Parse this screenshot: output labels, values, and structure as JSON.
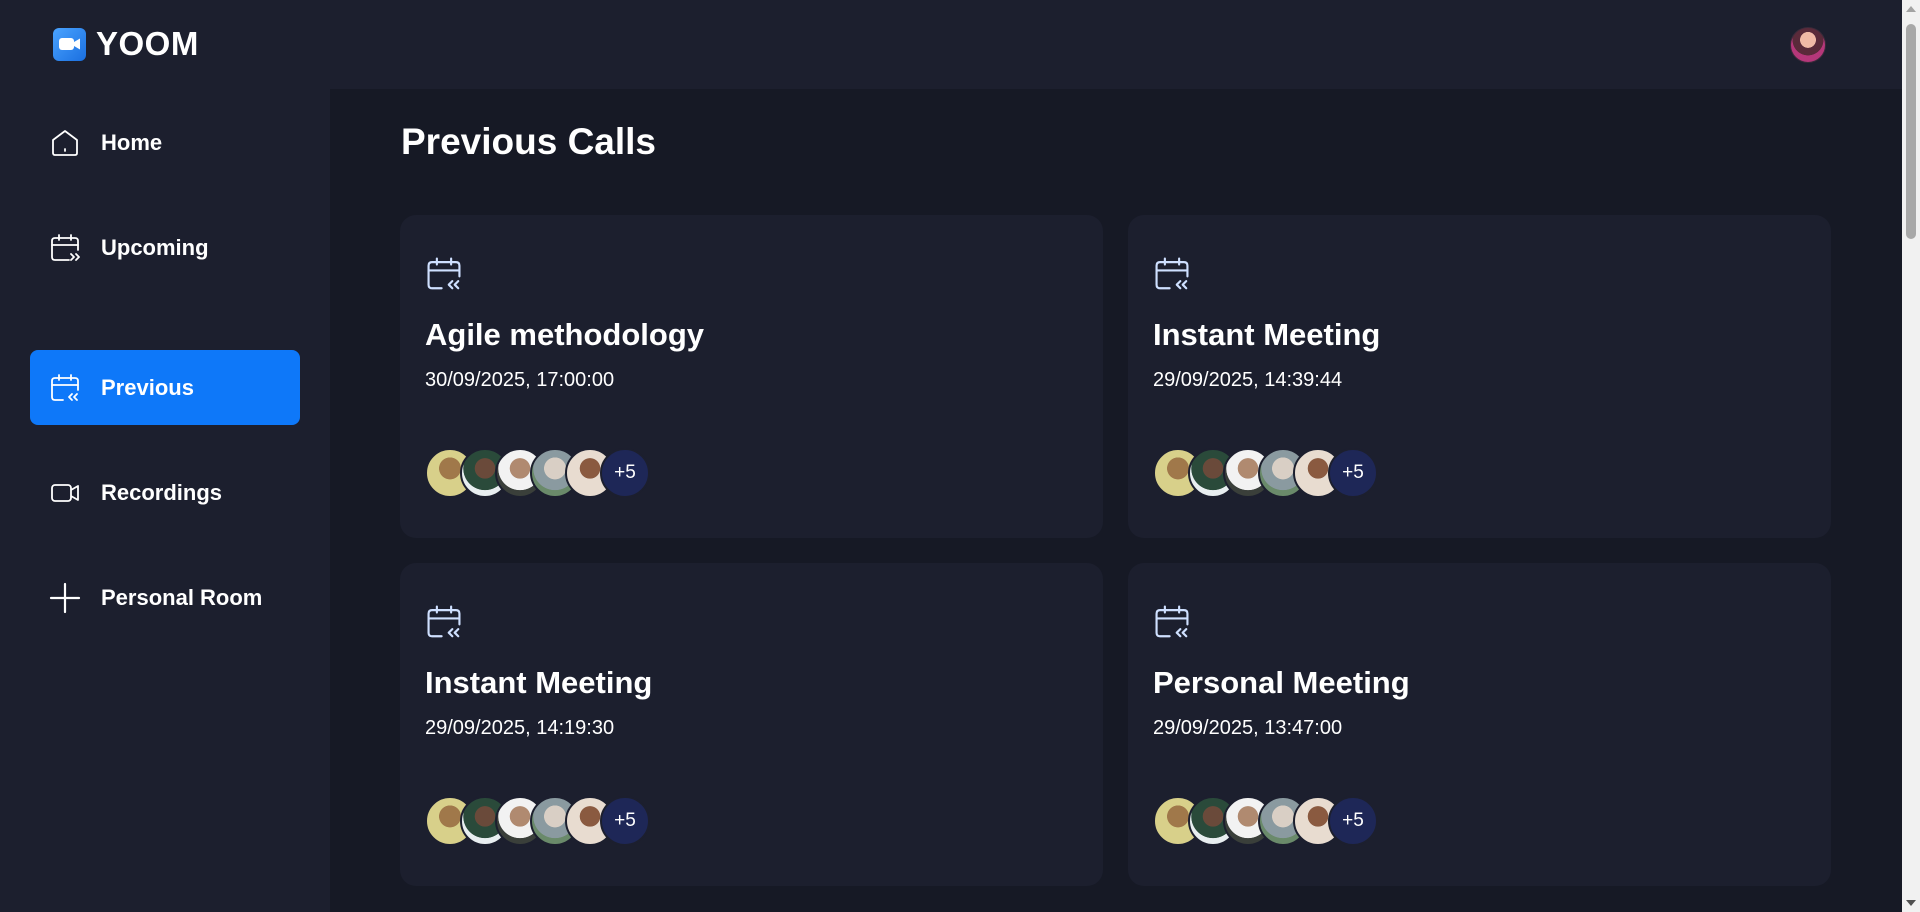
{
  "brand": {
    "name": "YOOM",
    "logo_icon": "video-camera-icon"
  },
  "user": {
    "avatar_icon": "user-avatar"
  },
  "sidebar": {
    "items": [
      {
        "label": "Home",
        "icon": "home-icon",
        "active": false
      },
      {
        "label": "Upcoming",
        "icon": "calendar-upcoming-icon",
        "active": false
      },
      {
        "label": "Previous",
        "icon": "calendar-previous-icon",
        "active": true
      },
      {
        "label": "Recordings",
        "icon": "video-icon",
        "active": false
      },
      {
        "label": "Personal Room",
        "icon": "plus-icon",
        "active": false
      }
    ]
  },
  "main": {
    "title": "Previous Calls",
    "cards": [
      {
        "title": "Agile methodology",
        "date": "30/09/2025, 17:00:00",
        "more": "+5"
      },
      {
        "title": "Instant Meeting",
        "date": "29/09/2025, 14:39:44",
        "more": "+5"
      },
      {
        "title": "Instant Meeting",
        "date": "29/09/2025, 14:19:30",
        "more": "+5"
      },
      {
        "title": "Personal Meeting",
        "date": "29/09/2025, 13:47:00",
        "more": "+5"
      }
    ]
  },
  "colors": {
    "background": "#161925",
    "panel": "#1c1f2e",
    "accent": "#0e78f9",
    "more_badge": "#1e2757"
  }
}
